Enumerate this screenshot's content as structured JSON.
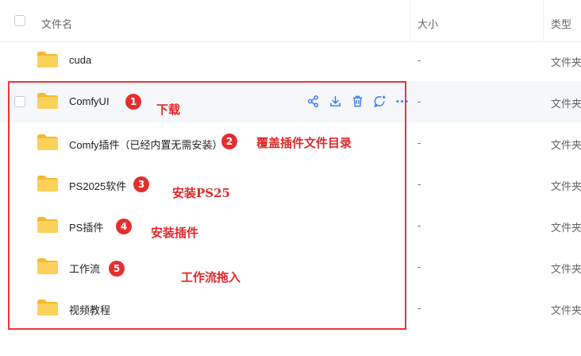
{
  "header": {
    "col_name": "文件名",
    "col_size": "大小",
    "col_type": "类型"
  },
  "rows": [
    {
      "name": "cuda",
      "size": "-",
      "type": "文件夹"
    },
    {
      "name": "ComfyUI",
      "size": "-",
      "type": "文件夹"
    },
    {
      "name": "Comfy插件（已经内置无需安装）",
      "size": "-",
      "type": "文件夹"
    },
    {
      "name": "PS2025软件",
      "size": "-",
      "type": "文件夹"
    },
    {
      "name": "PS插件",
      "size": "-",
      "type": "文件夹"
    },
    {
      "name": "工作流",
      "size": "-",
      "type": "文件夹"
    },
    {
      "name": "视频教程",
      "size": "-",
      "type": "文件夹"
    }
  ],
  "row_actions": [
    "share-icon",
    "download-icon",
    "delete-icon",
    "comment-icon",
    "more-icon"
  ],
  "annotations": [
    {
      "num": "1",
      "text": "下载"
    },
    {
      "num": "2",
      "text": "覆盖插件文件目录"
    },
    {
      "num": "3",
      "text": "安装PS25"
    },
    {
      "num": "4",
      "text": "安装插件"
    },
    {
      "num": "5",
      "text": "工作流拖入"
    }
  ],
  "colors": {
    "folder": "#f9c93d",
    "accent": "#3a78f2",
    "annotation_red": "#e3302f"
  }
}
